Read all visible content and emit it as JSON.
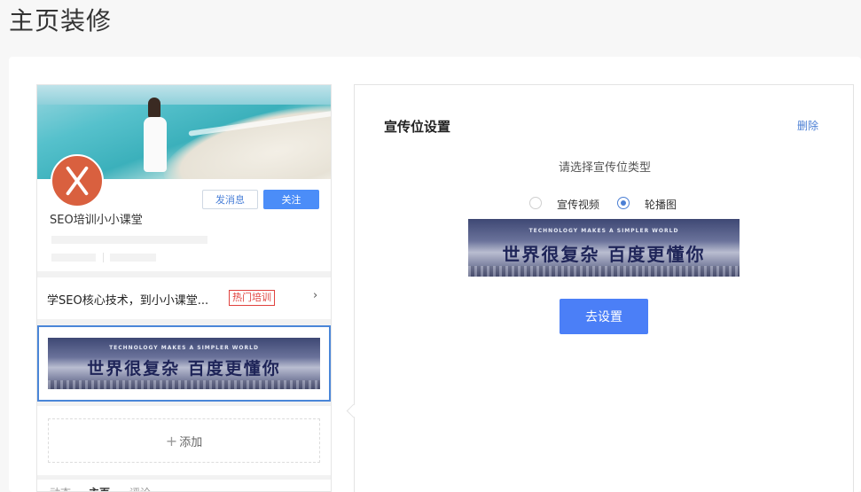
{
  "page": {
    "title": "主页装修"
  },
  "preview": {
    "shop_name": "SEO培训小小课堂",
    "buttons": {
      "message": "发消息",
      "follow": "关注"
    },
    "course": {
      "text": "学SEO核心技术，到小小课堂...",
      "tag": "热门培训"
    },
    "banner": {
      "tagline": "TECHNOLOGY MAKES A SIMPLER WORLD",
      "slogan": "世界很复杂 百度更懂你"
    },
    "add_label": "添加",
    "tabs": [
      "动态",
      "主页",
      "评论"
    ]
  },
  "panel": {
    "title": "宣传位设置",
    "delete": "删除",
    "choose_label": "请选择宣传位类型",
    "options": [
      {
        "label": "宣传视频",
        "checked": false
      },
      {
        "label": "轮播图",
        "checked": true
      }
    ],
    "banner": {
      "tagline": "TECHNOLOGY MAKES A SIMPLER WORLD",
      "slogan": "世界很复杂 百度更懂你"
    },
    "setup_button": "去设置"
  },
  "colors": {
    "accent": "#4b7ff7",
    "link": "#4b7fd4",
    "hot_tag": "#e0423e",
    "avatar": "#d9603f"
  }
}
